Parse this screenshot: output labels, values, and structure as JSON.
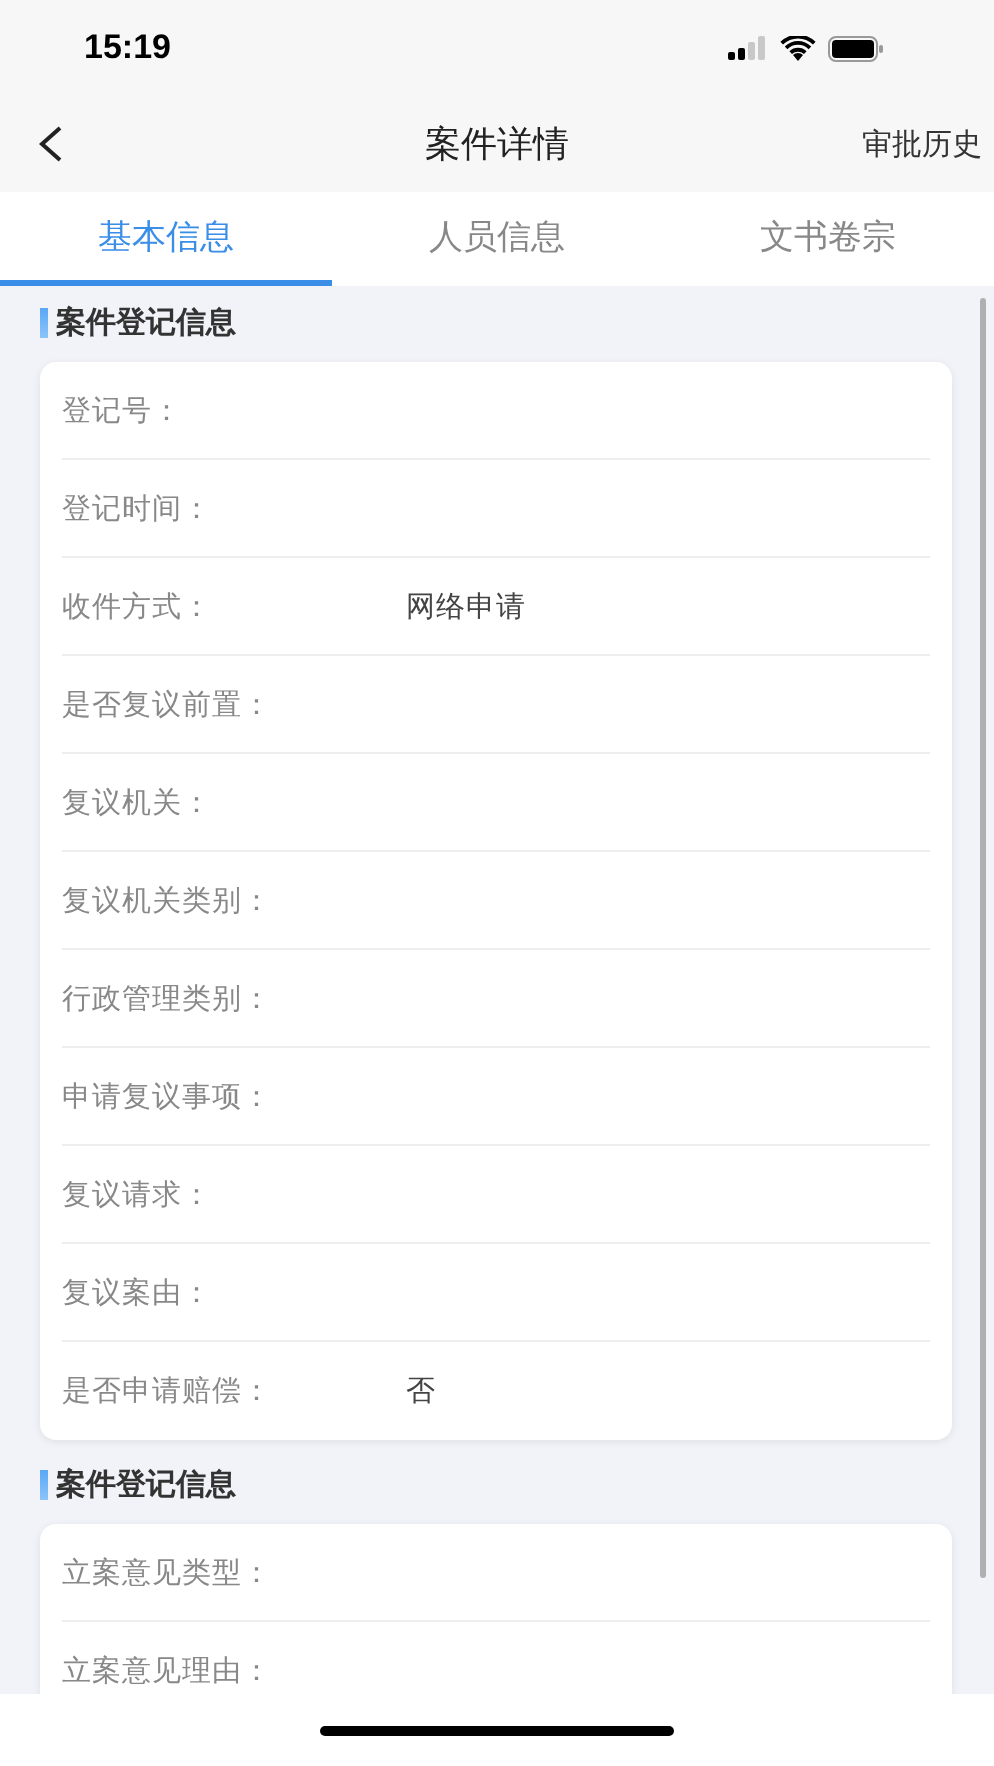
{
  "status_bar": {
    "time": "15:19"
  },
  "nav": {
    "title": "案件详情",
    "action": "审批历史"
  },
  "tabs": [
    {
      "label": "基本信息",
      "selected": true
    },
    {
      "label": "人员信息",
      "selected": false
    },
    {
      "label": "文书卷宗",
      "selected": false
    }
  ],
  "sections": [
    {
      "title": "案件登记信息",
      "fields": [
        {
          "label": "登记号："
        },
        {
          "label": "登记时间："
        },
        {
          "label": "收件方式：",
          "value": "网络申请"
        },
        {
          "label": "是否复议前置："
        },
        {
          "label": "复议机关："
        },
        {
          "label": "复议机关类别："
        },
        {
          "label": "行政管理类别："
        },
        {
          "label": "申请复议事项："
        },
        {
          "label": "复议请求："
        },
        {
          "label": "复议案由："
        },
        {
          "label": "是否申请赔偿：",
          "value": "否"
        }
      ]
    },
    {
      "title": "案件登记信息",
      "fields": [
        {
          "label": "立案意见类型："
        },
        {
          "label": "立案意见理由："
        }
      ]
    }
  ]
}
